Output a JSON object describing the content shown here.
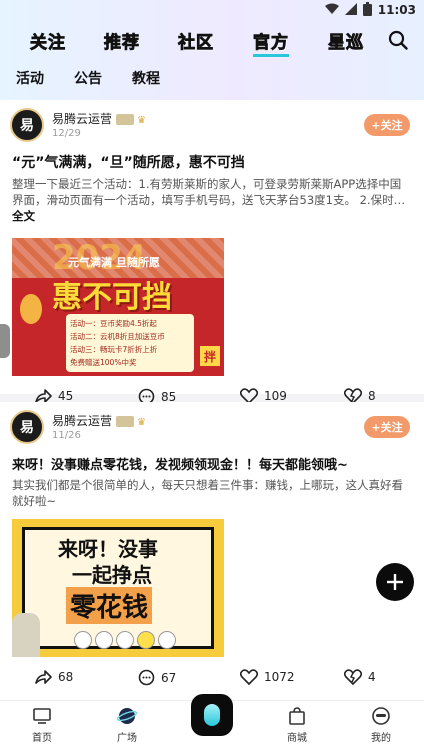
{
  "status": {
    "time": "11:03"
  },
  "tabs": [
    {
      "label": "关注"
    },
    {
      "label": "推荐"
    },
    {
      "label": "社区"
    },
    {
      "label": "官方"
    },
    {
      "label": "星巡"
    }
  ],
  "subtabs": [
    {
      "label": "活动"
    },
    {
      "label": "公告"
    },
    {
      "label": "教程"
    }
  ],
  "posts": [
    {
      "author": "易腾云运营",
      "date": "12/29",
      "follow": "+关注",
      "title": "“元”气满满，“旦”随所愿，惠不可挡",
      "body": "整理一下最近三个活动：1.有劳斯莱斯的家人，可登录劳斯莱斯APP选择中国界面，滑动页面有一个活动，填写手机号码，送飞天茅台53度1支。 2.保时",
      "more": "全文",
      "image": {
        "year": "2024",
        "subtitle": "元气满满 旦随所愿",
        "headline": "惠不可挡",
        "lines": [
          "活动一：豆币奖励4.5折起",
          "活动二：云机8折且加送豆币",
          "活动三：畅玩卡7折折上折",
          "免费赠送100%中奖"
        ],
        "tag": "拌"
      },
      "shares": "45",
      "comments": "85",
      "likes": "109",
      "favs": "8"
    },
    {
      "author": "易腾云运营",
      "date": "11/26",
      "follow": "+关注",
      "title": "来呀！没事赚点零花钱，发视频领现金！！每天都能领哦~",
      "body": "其实我们都是个很简单的人，每天只想着三件事：赚钱，上哪玩，这人真好看 就好啦~",
      "image": {
        "line1": "来呀！没事",
        "line2": "一起挣点",
        "line3": "零花钱"
      },
      "shares": "68",
      "comments": "67",
      "likes": "1072",
      "favs": "4"
    }
  ],
  "nav": [
    {
      "label": "首页"
    },
    {
      "label": "广场"
    },
    {
      "label": "商城"
    },
    {
      "label": "我的"
    }
  ],
  "colors": {
    "accent": "#28c8d8",
    "follow": "#f39a6a",
    "poster1_bg": "#c5262a",
    "poster2_bg": "#f7cc3c"
  }
}
